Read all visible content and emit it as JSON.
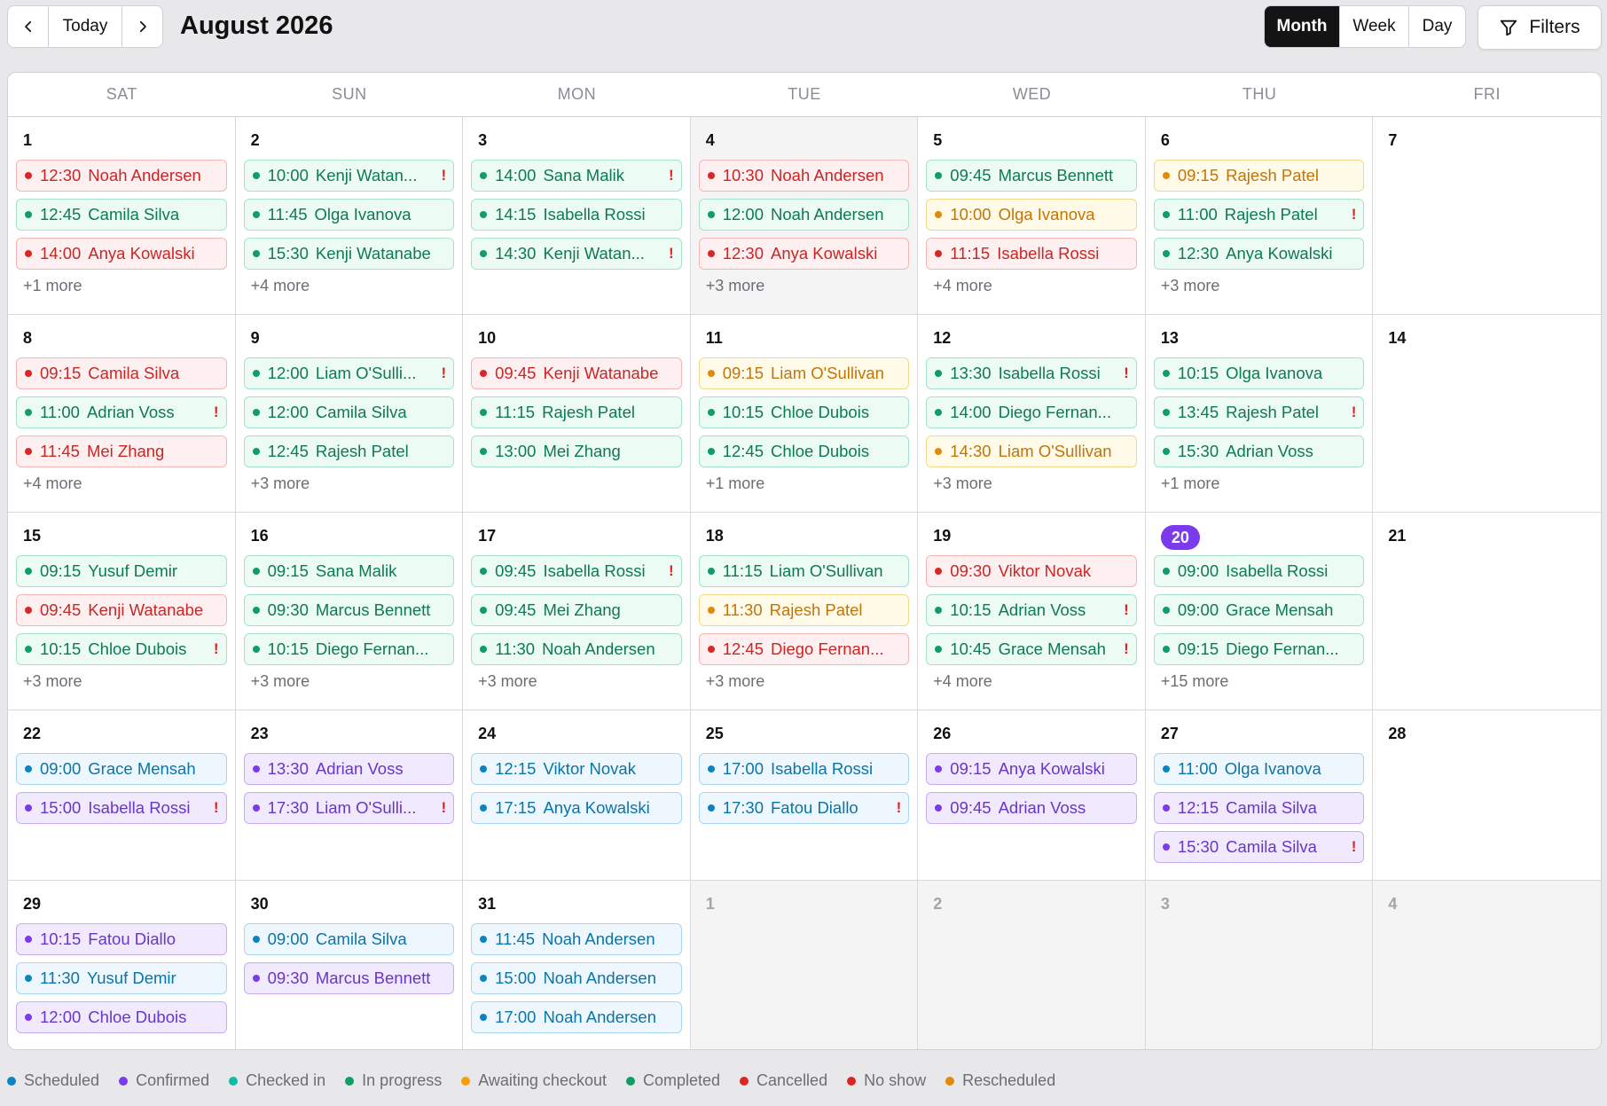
{
  "header": {
    "prev_label": "‹",
    "today_label": "Today",
    "next_label": "›",
    "title": "August 2026",
    "views": [
      "Month",
      "Week",
      "Day"
    ],
    "active_view": "Month",
    "filters_label": "Filters"
  },
  "weekdays": [
    "SAT",
    "SUN",
    "MON",
    "TUE",
    "WED",
    "THU",
    "FRI"
  ],
  "status_colors": {
    "red": "#dc2626",
    "green": "#0f9f65",
    "amber": "#e08a0a",
    "blue": "#0b84c2",
    "purple": "#7c3aed"
  },
  "days": [
    {
      "day": "1",
      "events": [
        {
          "time": "12:30",
          "name": "Noah Andersen",
          "color": "red",
          "flag": false
        },
        {
          "time": "12:45",
          "name": "Camila Silva",
          "color": "green",
          "flag": false
        },
        {
          "time": "14:00",
          "name": "Anya Kowalski",
          "color": "red",
          "flag": false
        }
      ],
      "more": "+1 more"
    },
    {
      "day": "2",
      "events": [
        {
          "time": "10:00",
          "name": "Kenji Watan...",
          "color": "green",
          "flag": true
        },
        {
          "time": "11:45",
          "name": "Olga Ivanova",
          "color": "green",
          "flag": false
        },
        {
          "time": "15:30",
          "name": "Kenji Watanabe",
          "color": "green",
          "flag": false
        }
      ],
      "more": "+4 more"
    },
    {
      "day": "3",
      "events": [
        {
          "time": "14:00",
          "name": "Sana Malik",
          "color": "green",
          "flag": true
        },
        {
          "time": "14:15",
          "name": "Isabella Rossi",
          "color": "green",
          "flag": false
        },
        {
          "time": "14:30",
          "name": "Kenji Watan...",
          "color": "green",
          "flag": true
        }
      ],
      "more": ""
    },
    {
      "day": "4",
      "shaded": true,
      "events": [
        {
          "time": "10:30",
          "name": "Noah Andersen",
          "color": "red",
          "flag": false
        },
        {
          "time": "12:00",
          "name": "Noah Andersen",
          "color": "green",
          "flag": false
        },
        {
          "time": "12:30",
          "name": "Anya Kowalski",
          "color": "red",
          "flag": false
        }
      ],
      "more": "+3 more"
    },
    {
      "day": "5",
      "events": [
        {
          "time": "09:45",
          "name": "Marcus Bennett",
          "color": "green",
          "flag": false
        },
        {
          "time": "10:00",
          "name": "Olga Ivanova",
          "color": "amber",
          "flag": false
        },
        {
          "time": "11:15",
          "name": "Isabella Rossi",
          "color": "red",
          "flag": false
        }
      ],
      "more": "+4 more"
    },
    {
      "day": "6",
      "events": [
        {
          "time": "09:15",
          "name": "Rajesh Patel",
          "color": "amber",
          "flag": false
        },
        {
          "time": "11:00",
          "name": "Rajesh Patel",
          "color": "green",
          "flag": true
        },
        {
          "time": "12:30",
          "name": "Anya Kowalski",
          "color": "green",
          "flag": false
        }
      ],
      "more": "+3 more"
    },
    {
      "day": "7",
      "events": [],
      "more": ""
    },
    {
      "day": "8",
      "events": [
        {
          "time": "09:15",
          "name": "Camila Silva",
          "color": "red",
          "flag": false
        },
        {
          "time": "11:00",
          "name": "Adrian Voss",
          "color": "green",
          "flag": true
        },
        {
          "time": "11:45",
          "name": "Mei Zhang",
          "color": "red",
          "flag": false
        }
      ],
      "more": "+4 more"
    },
    {
      "day": "9",
      "events": [
        {
          "time": "12:00",
          "name": "Liam O'Sulli...",
          "color": "green",
          "flag": true
        },
        {
          "time": "12:00",
          "name": "Camila Silva",
          "color": "green",
          "flag": false
        },
        {
          "time": "12:45",
          "name": "Rajesh Patel",
          "color": "green",
          "flag": false
        }
      ],
      "more": "+3 more"
    },
    {
      "day": "10",
      "events": [
        {
          "time": "09:45",
          "name": "Kenji Watanabe",
          "color": "red",
          "flag": false
        },
        {
          "time": "11:15",
          "name": "Rajesh Patel",
          "color": "green",
          "flag": false
        },
        {
          "time": "13:00",
          "name": "Mei Zhang",
          "color": "green",
          "flag": false
        }
      ],
      "more": ""
    },
    {
      "day": "11",
      "events": [
        {
          "time": "09:15",
          "name": "Liam O'Sullivan",
          "color": "amber",
          "flag": false
        },
        {
          "time": "10:15",
          "name": "Chloe Dubois",
          "color": "green",
          "flag": false
        },
        {
          "time": "12:45",
          "name": "Chloe Dubois",
          "color": "green",
          "flag": false
        }
      ],
      "more": "+1 more"
    },
    {
      "day": "12",
      "events": [
        {
          "time": "13:30",
          "name": "Isabella Rossi",
          "color": "green",
          "flag": true
        },
        {
          "time": "14:00",
          "name": "Diego Fernan...",
          "color": "green",
          "flag": false
        },
        {
          "time": "14:30",
          "name": "Liam O'Sullivan",
          "color": "amber",
          "flag": false
        }
      ],
      "more": "+3 more"
    },
    {
      "day": "13",
      "events": [
        {
          "time": "10:15",
          "name": "Olga Ivanova",
          "color": "green",
          "flag": false
        },
        {
          "time": "13:45",
          "name": "Rajesh Patel",
          "color": "green",
          "flag": true
        },
        {
          "time": "15:30",
          "name": "Adrian Voss",
          "color": "green",
          "flag": false
        }
      ],
      "more": "+1 more"
    },
    {
      "day": "14",
      "events": [],
      "more": ""
    },
    {
      "day": "15",
      "events": [
        {
          "time": "09:15",
          "name": "Yusuf Demir",
          "color": "green",
          "flag": false
        },
        {
          "time": "09:45",
          "name": "Kenji Watanabe",
          "color": "red",
          "flag": false
        },
        {
          "time": "10:15",
          "name": "Chloe Dubois",
          "color": "green",
          "flag": true
        }
      ],
      "more": "+3 more"
    },
    {
      "day": "16",
      "events": [
        {
          "time": "09:15",
          "name": "Sana Malik",
          "color": "green",
          "flag": false
        },
        {
          "time": "09:30",
          "name": "Marcus Bennett",
          "color": "green",
          "flag": false
        },
        {
          "time": "10:15",
          "name": "Diego Fernan...",
          "color": "green",
          "flag": false
        }
      ],
      "more": "+3 more"
    },
    {
      "day": "17",
      "events": [
        {
          "time": "09:45",
          "name": "Isabella Rossi",
          "color": "green",
          "flag": true
        },
        {
          "time": "09:45",
          "name": "Mei Zhang",
          "color": "green",
          "flag": false
        },
        {
          "time": "11:30",
          "name": "Noah Andersen",
          "color": "green",
          "flag": false
        }
      ],
      "more": "+3 more"
    },
    {
      "day": "18",
      "events": [
        {
          "time": "11:15",
          "name": "Liam O'Sullivan",
          "color": "green",
          "flag": false
        },
        {
          "time": "11:30",
          "name": "Rajesh Patel",
          "color": "amber",
          "flag": false
        },
        {
          "time": "12:45",
          "name": "Diego Fernan...",
          "color": "red",
          "flag": false
        }
      ],
      "more": "+3 more"
    },
    {
      "day": "19",
      "events": [
        {
          "time": "09:30",
          "name": "Viktor Novak",
          "color": "red",
          "flag": false
        },
        {
          "time": "10:15",
          "name": "Adrian Voss",
          "color": "green",
          "flag": true
        },
        {
          "time": "10:45",
          "name": "Grace Mensah",
          "color": "green",
          "flag": true
        }
      ],
      "more": "+4 more"
    },
    {
      "day": "20",
      "today": true,
      "events": [
        {
          "time": "09:00",
          "name": "Isabella Rossi",
          "color": "green",
          "flag": false
        },
        {
          "time": "09:00",
          "name": "Grace Mensah",
          "color": "green",
          "flag": false
        },
        {
          "time": "09:15",
          "name": "Diego Fernan...",
          "color": "green",
          "flag": false
        }
      ],
      "more": "+15 more"
    },
    {
      "day": "21",
      "events": [],
      "more": ""
    },
    {
      "day": "22",
      "events": [
        {
          "time": "09:00",
          "name": "Grace Mensah",
          "color": "blue",
          "flag": false
        },
        {
          "time": "15:00",
          "name": "Isabella Rossi",
          "color": "purple",
          "flag": true
        }
      ],
      "more": ""
    },
    {
      "day": "23",
      "events": [
        {
          "time": "13:30",
          "name": "Adrian Voss",
          "color": "purple",
          "flag": false
        },
        {
          "time": "17:30",
          "name": "Liam O'Sulli...",
          "color": "purple",
          "flag": true
        }
      ],
      "more": ""
    },
    {
      "day": "24",
      "events": [
        {
          "time": "12:15",
          "name": "Viktor Novak",
          "color": "blue",
          "flag": false
        },
        {
          "time": "17:15",
          "name": "Anya Kowalski",
          "color": "blue",
          "flag": false
        }
      ],
      "more": ""
    },
    {
      "day": "25",
      "events": [
        {
          "time": "17:00",
          "name": "Isabella Rossi",
          "color": "blue",
          "flag": false
        },
        {
          "time": "17:30",
          "name": "Fatou Diallo",
          "color": "blue",
          "flag": true
        }
      ],
      "more": ""
    },
    {
      "day": "26",
      "events": [
        {
          "time": "09:15",
          "name": "Anya Kowalski",
          "color": "purple",
          "flag": false
        },
        {
          "time": "09:45",
          "name": "Adrian Voss",
          "color": "purple",
          "flag": false
        }
      ],
      "more": ""
    },
    {
      "day": "27",
      "events": [
        {
          "time": "11:00",
          "name": "Olga Ivanova",
          "color": "blue",
          "flag": false
        },
        {
          "time": "12:15",
          "name": "Camila Silva",
          "color": "purple",
          "flag": false
        },
        {
          "time": "15:30",
          "name": "Camila Silva",
          "color": "purple",
          "flag": true
        }
      ],
      "more": ""
    },
    {
      "day": "28",
      "events": [],
      "more": ""
    },
    {
      "day": "29",
      "events": [
        {
          "time": "10:15",
          "name": "Fatou Diallo",
          "color": "purple",
          "flag": false
        },
        {
          "time": "11:30",
          "name": "Yusuf Demir",
          "color": "blue",
          "flag": false
        },
        {
          "time": "12:00",
          "name": "Chloe Dubois",
          "color": "purple",
          "flag": false
        }
      ],
      "more": ""
    },
    {
      "day": "30",
      "events": [
        {
          "time": "09:00",
          "name": "Camila Silva",
          "color": "blue",
          "flag": false
        },
        {
          "time": "09:30",
          "name": "Marcus Bennett",
          "color": "purple",
          "flag": false
        }
      ],
      "more": ""
    },
    {
      "day": "31",
      "events": [
        {
          "time": "11:45",
          "name": "Noah Andersen",
          "color": "blue",
          "flag": false
        },
        {
          "time": "15:00",
          "name": "Noah Andersen",
          "color": "blue",
          "flag": false
        },
        {
          "time": "17:00",
          "name": "Noah Andersen",
          "color": "blue",
          "flag": false
        }
      ],
      "more": ""
    },
    {
      "day": "1",
      "outside": true,
      "events": [],
      "more": ""
    },
    {
      "day": "2",
      "outside": true,
      "events": [],
      "more": ""
    },
    {
      "day": "3",
      "outside": true,
      "events": [],
      "more": ""
    },
    {
      "day": "4",
      "outside": true,
      "events": [],
      "more": ""
    }
  ],
  "flag_symbol": "!",
  "legend": [
    {
      "label": "Scheduled",
      "color": "#0b84c2"
    },
    {
      "label": "Confirmed",
      "color": "#7c3aed"
    },
    {
      "label": "Checked in",
      "color": "#14b8a6"
    },
    {
      "label": "In progress",
      "color": "#0f9f65"
    },
    {
      "label": "Awaiting checkout",
      "color": "#f59e0b"
    },
    {
      "label": "Completed",
      "color": "#0f9f65"
    },
    {
      "label": "Cancelled",
      "color": "#dc2626"
    },
    {
      "label": "No show",
      "color": "#dc2626"
    },
    {
      "label": "Rescheduled",
      "color": "#e08a0a"
    }
  ]
}
